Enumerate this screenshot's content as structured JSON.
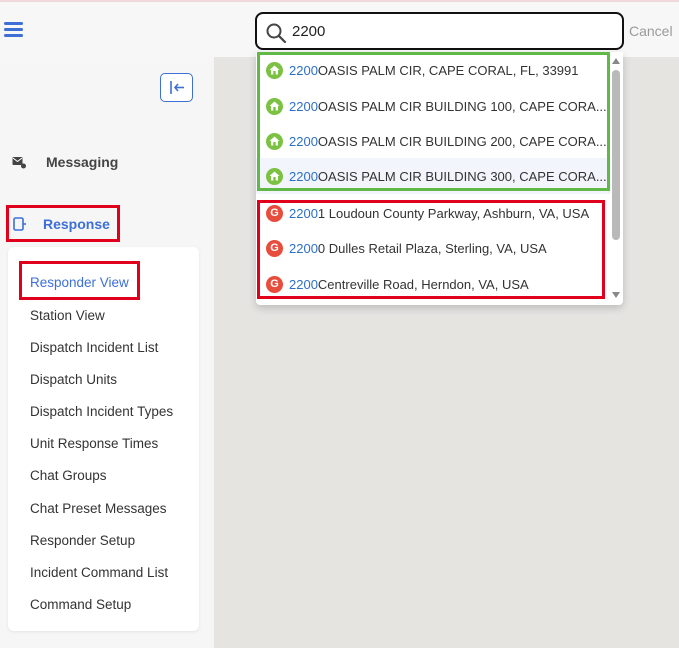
{
  "header": {
    "menu_icon": "hamburger-icon",
    "search_value": "2200",
    "search_icon": "search-icon",
    "cancel_label": "Cancel"
  },
  "sidebar": {
    "collapse_icon": "collapse-left-icon",
    "items": [
      {
        "label": "Messaging",
        "icon": "message-icon"
      },
      {
        "label": "Response",
        "icon": "response-icon"
      }
    ],
    "submenu": [
      "Responder View",
      "Station View",
      "Dispatch Incident List",
      "Dispatch Units",
      "Dispatch Incident Types",
      "Unit Response Times",
      "Chat Groups",
      "Chat Preset Messages",
      "Responder Setup",
      "Incident Command List",
      "Command Setup"
    ]
  },
  "results": {
    "local": [
      {
        "match": "2200",
        "rest": " OASIS PALM CIR, CAPE CORAL, FL, 33991",
        "icon": "home-icon"
      },
      {
        "match": "2200",
        "rest": " OASIS PALM CIR BUILDING 100, CAPE CORA...",
        "icon": "home-icon"
      },
      {
        "match": "2200",
        "rest": " OASIS PALM CIR BUILDING 200, CAPE CORA...",
        "icon": "home-icon"
      },
      {
        "match": "2200",
        "rest": " OASIS PALM CIR BUILDING 300, CAPE CORA...",
        "icon": "home-icon"
      }
    ],
    "google": [
      {
        "match": "2200",
        "rest": "1 Loudoun County Parkway, Ashburn, VA, USA",
        "icon": "google-icon"
      },
      {
        "match": "2200",
        "rest": "0 Dulles Retail Plaza, Sterling, VA, USA",
        "icon": "google-icon"
      },
      {
        "match": "2200",
        "rest": " Centreville Road, Herndon, VA, USA",
        "icon": "google-icon"
      }
    ]
  },
  "colors": {
    "accent": "#3d6fd6",
    "match_text": "#2d6fc7",
    "highlight_red": "#e0001b",
    "highlight_green": "#60b846",
    "home_icon": "#7cc242",
    "google_icon": "#e74c3c"
  }
}
